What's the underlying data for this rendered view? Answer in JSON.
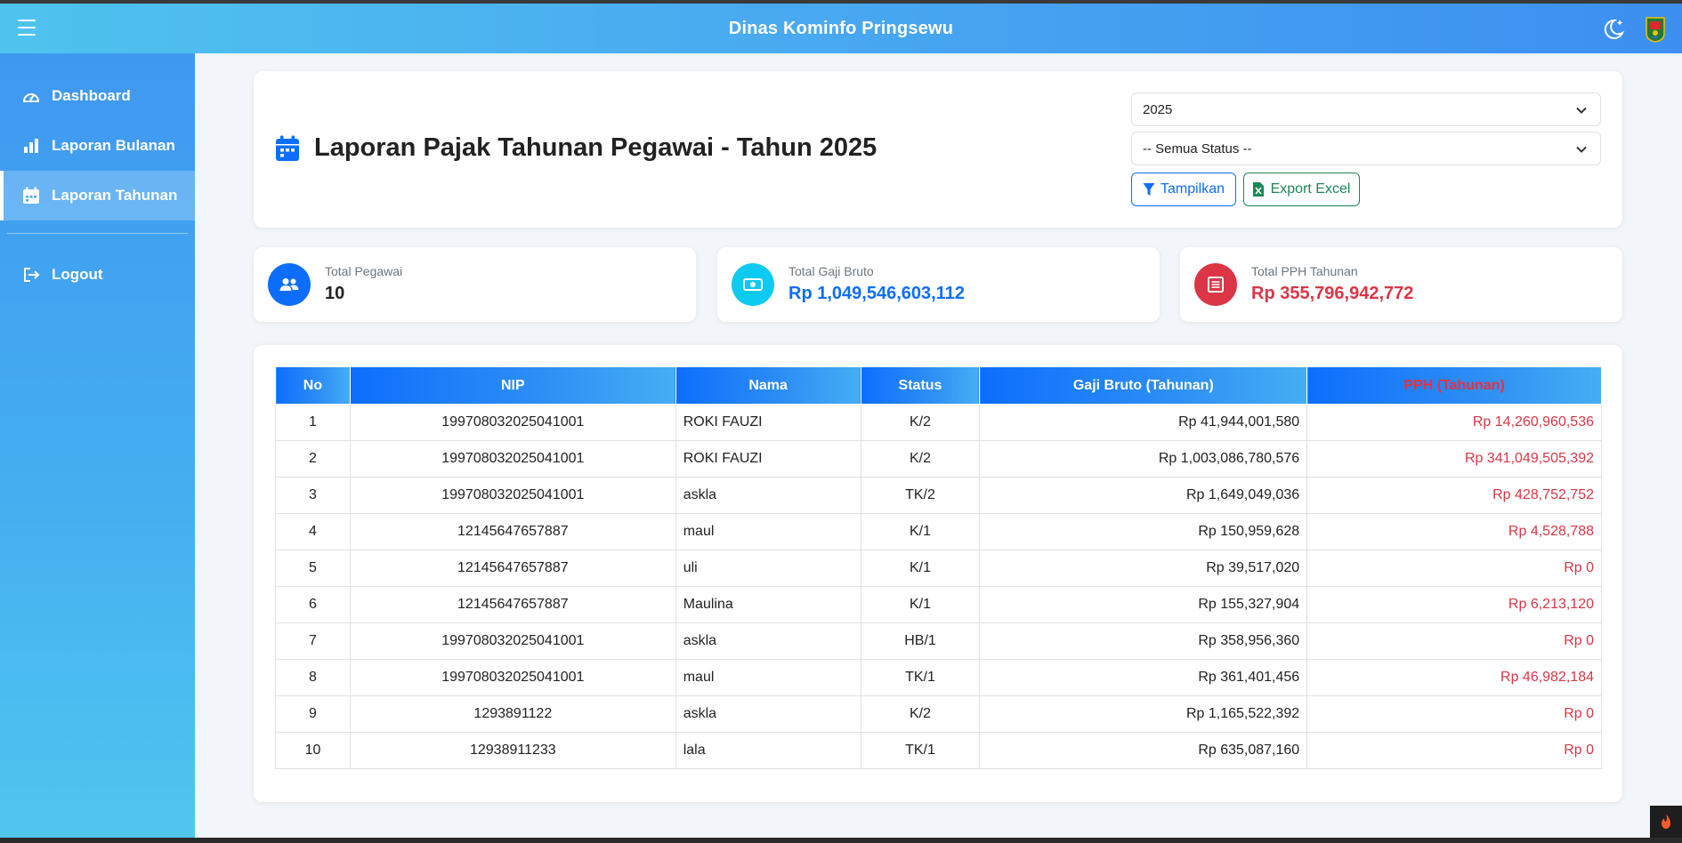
{
  "navbar": {
    "brand": "Dinas Kominfo Pringsewu",
    "menu_icon": "hamburger-icon",
    "theme_icon": "moon-stars-icon",
    "logo_icon": "regency-crest-logo"
  },
  "sidebar": {
    "items": [
      {
        "label": "Dashboard",
        "icon": "speedometer-icon"
      },
      {
        "label": "Laporan Bulanan",
        "icon": "bar-chart-icon"
      },
      {
        "label": "Laporan Tahunan",
        "icon": "calendar-icon",
        "active": true
      }
    ],
    "logout": {
      "label": "Logout",
      "icon": "logout-icon"
    }
  },
  "header": {
    "title": "Laporan Pajak Tahunan Pegawai - Tahun 2025",
    "title_icon": "calendar-icon",
    "year_select": {
      "value": "2025"
    },
    "status_select": {
      "value": "-- Semua Status --"
    },
    "btn_show": "Tampilkan",
    "btn_excel": "Export Excel"
  },
  "stats": {
    "total_pegawai": {
      "label": "Total Pegawai",
      "value": "10",
      "icon": "people-icon",
      "color": "#0d6efd"
    },
    "total_gaji": {
      "label": "Total Gaji Bruto",
      "value": "Rp 1,049,546,603,112",
      "icon": "cash-icon",
      "color": "#0dcaf0"
    },
    "total_pph": {
      "label": "Total PPH Tahunan",
      "value": "Rp 355,796,942,772",
      "icon": "receipt-icon",
      "color": "#dc3545"
    }
  },
  "table": {
    "columns": [
      "No",
      "NIP",
      "Nama",
      "Status",
      "Gaji Bruto (Tahunan)",
      "PPH (Tahunan)"
    ],
    "rows": [
      {
        "no": "1",
        "nip": "199708032025041001",
        "nama": "ROKI FAUZI",
        "status": "K/2",
        "gaji": "Rp 41,944,001,580",
        "pph": "Rp 14,260,960,536"
      },
      {
        "no": "2",
        "nip": "199708032025041001",
        "nama": "ROKI FAUZI",
        "status": "K/2",
        "gaji": "Rp 1,003,086,780,576",
        "pph": "Rp 341,049,505,392"
      },
      {
        "no": "3",
        "nip": "199708032025041001",
        "nama": "askla",
        "status": "TK/2",
        "gaji": "Rp 1,649,049,036",
        "pph": "Rp 428,752,752"
      },
      {
        "no": "4",
        "nip": "12145647657887",
        "nama": "maul",
        "status": "K/1",
        "gaji": "Rp 150,959,628",
        "pph": "Rp 4,528,788"
      },
      {
        "no": "5",
        "nip": "12145647657887",
        "nama": "uli",
        "status": "K/1",
        "gaji": "Rp 39,517,020",
        "pph": "Rp 0"
      },
      {
        "no": "6",
        "nip": "12145647657887",
        "nama": "Maulina",
        "status": "K/1",
        "gaji": "Rp 155,327,904",
        "pph": "Rp 6,213,120"
      },
      {
        "no": "7",
        "nip": "199708032025041001",
        "nama": "askla",
        "status": "HB/1",
        "gaji": "Rp 358,956,360",
        "pph": "Rp 0"
      },
      {
        "no": "8",
        "nip": "199708032025041001",
        "nama": "maul",
        "status": "TK/1",
        "gaji": "Rp 361,401,456",
        "pph": "Rp 46,982,184"
      },
      {
        "no": "9",
        "nip": "1293891122",
        "nama": "askla",
        "status": "K/2",
        "gaji": "Rp 1,165,522,392",
        "pph": "Rp 0"
      },
      {
        "no": "10",
        "nip": "12938911233",
        "nama": "lala",
        "status": "TK/1",
        "gaji": "Rp 635,087,160",
        "pph": "Rp 0"
      }
    ]
  },
  "colors": {
    "primary": "#0d6efd",
    "danger": "#dc3545",
    "success": "#198754",
    "info": "#0dcaf0"
  }
}
